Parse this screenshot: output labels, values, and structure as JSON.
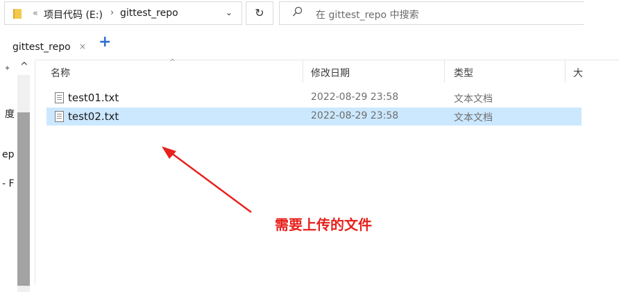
{
  "address_bar": {
    "overflow": "«",
    "crumbs": [
      "项目代码 (E:)",
      "gittest_repo"
    ],
    "separator": "›",
    "dropdown": "⌄",
    "refresh": "↻",
    "search_placeholder": "在 gittest_repo 中搜索"
  },
  "tabs": {
    "active_label": "gittest_repo",
    "close": "×",
    "add": "+"
  },
  "nav_pane": {
    "up": "^",
    "fragments": [
      "度",
      "ep",
      "- F"
    ]
  },
  "list": {
    "columns": [
      "名称",
      "修改日期",
      "类型",
      "大"
    ],
    "sort_indicator": "^",
    "files": [
      {
        "name": "test01.txt",
        "date": "2022-08-29 23:58",
        "type": "文本文档",
        "selected": false
      },
      {
        "name": "test02.txt",
        "date": "2022-08-29 23:58",
        "type": "文本文档",
        "selected": true
      }
    ]
  },
  "annotation": {
    "label": "需要上传的文件",
    "color": "#e8201c"
  },
  "colors": {
    "selection": "#cce8ff",
    "accent": "#2f6fd6",
    "folder": "#f2c94c"
  },
  "icons": [
    "folder-icon",
    "refresh-icon",
    "search-icon",
    "close-icon",
    "plus-icon",
    "pin-icon",
    "file-text-icon"
  ]
}
